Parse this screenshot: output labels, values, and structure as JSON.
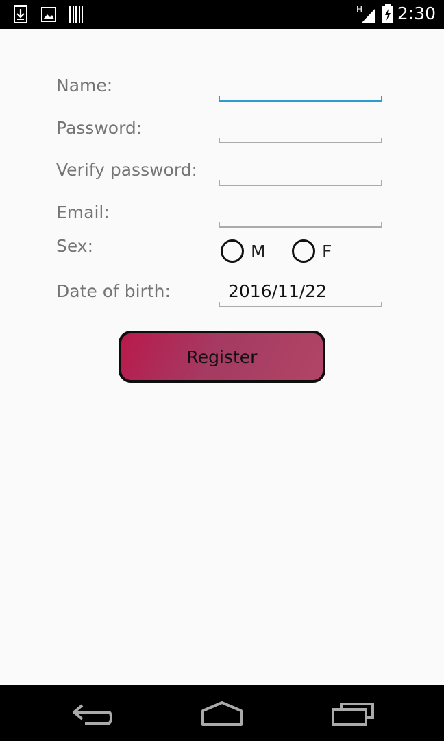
{
  "status_bar": {
    "time": "2:30",
    "network_letter": "H",
    "icons": [
      "download-icon",
      "image-icon",
      "barcode-icon",
      "signal-icon",
      "battery-charging-icon"
    ]
  },
  "form": {
    "name_label": "Name:",
    "name_value": "",
    "password_label": "Password:",
    "password_value": "",
    "verify_label": "Verify password:",
    "verify_value": "",
    "email_label": "Email:",
    "email_value": "",
    "sex_label": "Sex:",
    "sex_options": [
      "M",
      "F"
    ],
    "dob_label": "Date of birth:",
    "dob_value": "2016/11/22",
    "register_label": "Register"
  },
  "nav_bar": {
    "icons": [
      "back-icon",
      "home-icon",
      "recents-icon"
    ]
  },
  "colors": {
    "focus_accent": "#2b9bd1",
    "button_gradient_start": "#b81a4c",
    "button_gradient_end": "#b04566"
  }
}
